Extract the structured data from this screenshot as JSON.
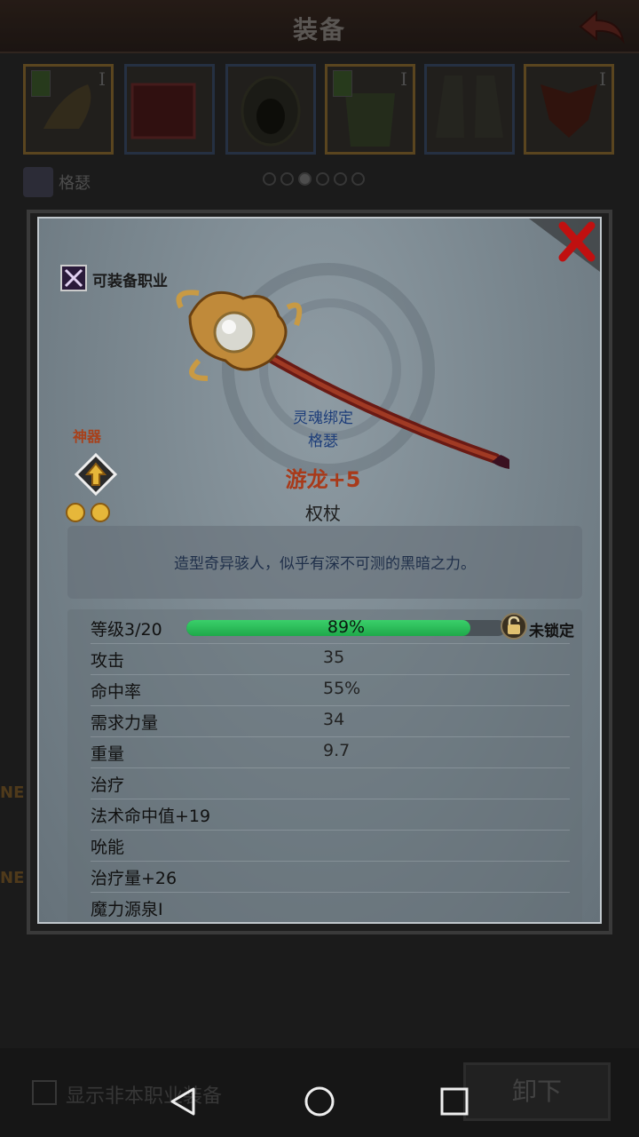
{
  "header": {
    "title": "装备"
  },
  "equipment_slots": [
    {
      "tier": "I",
      "highlight": true,
      "tree_badge": true
    },
    {
      "tier": "",
      "highlight": false,
      "tree_badge": false
    },
    {
      "tier": "",
      "highlight": false,
      "tree_badge": false
    },
    {
      "tier": "I",
      "highlight": true,
      "tree_badge": true
    },
    {
      "tier": "",
      "highlight": false,
      "tree_badge": false
    },
    {
      "tier": "I",
      "highlight": true,
      "tree_badge": false
    }
  ],
  "character": {
    "name": "格瑟"
  },
  "pager": {
    "total": 6,
    "active": 2
  },
  "side_labels": [
    "NE",
    "NE"
  ],
  "footer": {
    "show_non_class_label": "显示非本职业装备",
    "unequip_label": "卸下"
  },
  "item": {
    "class_label": "可装备职业",
    "soulbind_label": "灵魂绑定",
    "bound_to": "格瑟",
    "rarity": "神器",
    "gem_count": 2,
    "name": "游龙+5",
    "type": "权杖",
    "description": "造型奇异骇人，似乎有深不可测的黑暗之力。",
    "level_label": "等级3/20",
    "level_progress_pct": 89,
    "level_progress_text": "89%",
    "lock_label": "未锁定",
    "stats": [
      {
        "name": "攻击",
        "value": "35"
      },
      {
        "name": "命中率",
        "value": "55%"
      },
      {
        "name": "需求力量",
        "value": "34"
      },
      {
        "name": "重量",
        "value": "9.7"
      },
      {
        "name": "治疗",
        "value": ""
      },
      {
        "name": "法术命中值+19",
        "value": ""
      },
      {
        "name": "吮能",
        "value": ""
      },
      {
        "name": "治疗量+26",
        "value": ""
      },
      {
        "name": "魔力源泉I",
        "value": ""
      }
    ]
  },
  "colors": {
    "item_name": "#a83a1a",
    "rarity": "#a8401a",
    "soulbind": "#1e3e7a",
    "progress": "#2fbf5a",
    "close": "#c01010"
  }
}
